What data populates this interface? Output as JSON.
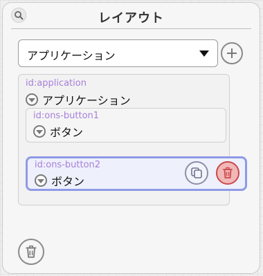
{
  "header": {
    "title": "レイアウト",
    "search_icon": "magnifier-icon"
  },
  "component_select": {
    "value": "アプリケーション"
  },
  "tree": {
    "root": {
      "id_text": "id:application",
      "label": "アプリケーション"
    },
    "children": [
      {
        "id_text": "id:ons-button1",
        "label": "ボタン",
        "selected": false
      },
      {
        "id_text": "id:ons-button2",
        "label": "ボタン",
        "selected": true
      }
    ]
  },
  "colors": {
    "id_text": "#a77fd9",
    "selected_border": "#8e9ae6",
    "selected_background": "#eef0fb",
    "delete_red": "#c94a4a",
    "delete_fill": "#f2b7b7"
  }
}
